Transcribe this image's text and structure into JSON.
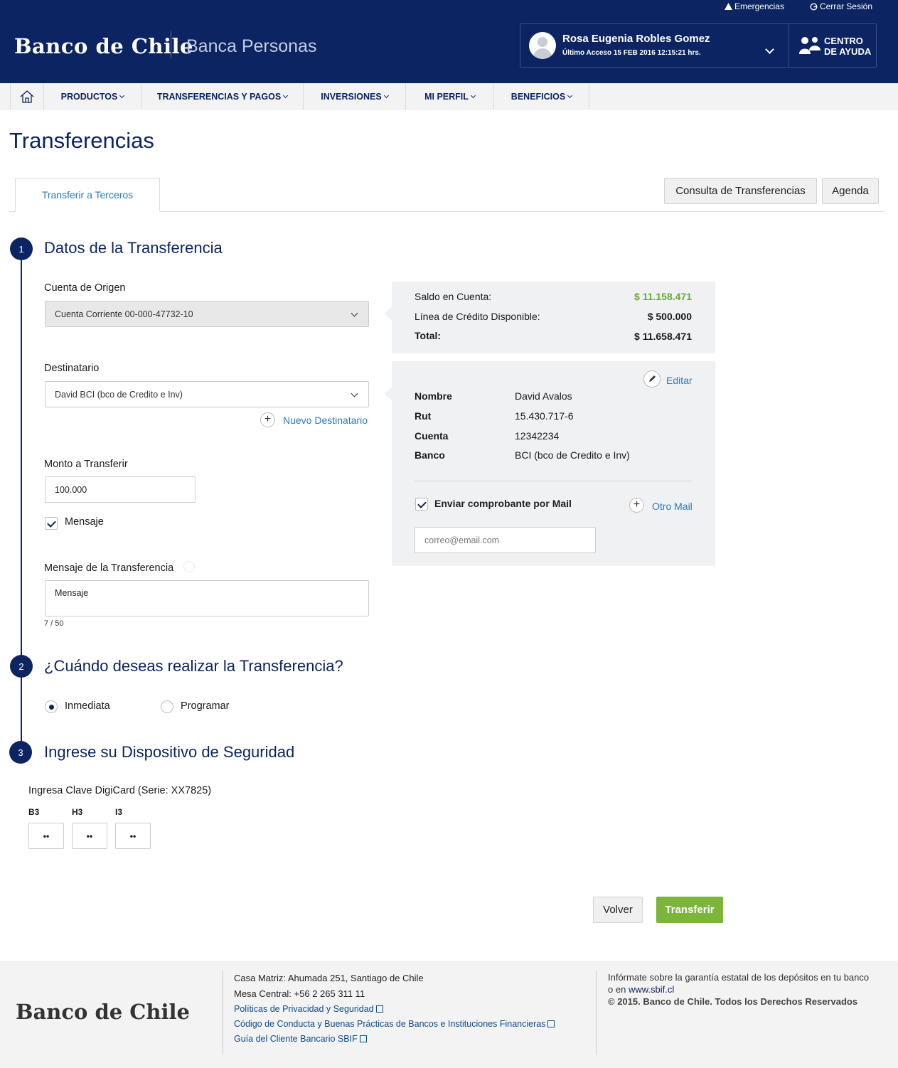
{
  "header": {
    "emergencias": "Emergencias",
    "cerrar_sesion": "Cerrar Sesión",
    "logo": "Banco de Chile",
    "section": "Banca Personas",
    "user_name": "Rosa Eugenia Robles Gomez",
    "last_access": "Último Acceso 15 FEB 2016 12:15:21 hrs.",
    "help_line1": "CENTRO",
    "help_line2": "DE AYUDA"
  },
  "nav": {
    "items": [
      "PRODUCTOS",
      "TRANSFERENCIAS Y PAGOS",
      "INVERSIONES",
      "MI PERFIL",
      "BENEFICIOS"
    ]
  },
  "page": {
    "title": "Transferencias",
    "tab_active": "Transferir a Terceros",
    "btn_consulta": "Consulta de Transferencias",
    "btn_agenda": "Agenda"
  },
  "step1": {
    "number": "1",
    "title": "Datos de la Transferencia",
    "origen_label": "Cuenta de Origen",
    "origen_value": "Cuenta Corriente 00-000-47732-10",
    "destinatario_label": "Destinatario",
    "destinatario_value": "David BCI (bco de Credito e Inv)",
    "nuevo_destinatario": "Nuevo Destinatario",
    "monto_label": "Monto a Transferir",
    "monto_value": "100.000",
    "mensaje_check": "Mensaje",
    "mensaje_label": "Mensaje de la Transferencia",
    "mensaje_value": "Mensaje",
    "char_count": "7 / 50"
  },
  "saldo": {
    "saldo_label": "Saldo en Cuenta:",
    "saldo_value": "$ 11.158.471",
    "linea_label": "Línea de Crédito Disponible:",
    "linea_value": "$ 500.000",
    "total_label": "Total:",
    "total_value": "$ 11.658.471",
    "saldo_color": "#6aaa2c"
  },
  "destinatario_panel": {
    "editar": "Editar",
    "nombre_label": "Nombre",
    "nombre_value": "David Avalos",
    "rut_label": "Rut",
    "rut_value": "15.430.717-6",
    "cuenta_label": "Cuenta",
    "cuenta_value": "12342234",
    "banco_label": "Banco",
    "banco_value": "BCI (bco de Credito e Inv)",
    "enviar_mail": "Enviar comprobante por Mail",
    "otro_mail": "Otro Mail",
    "email_placeholder": "correo@email.com"
  },
  "step2": {
    "number": "2",
    "title": "¿Cuándo deseas realizar la Transferencia?",
    "opt_inmediata": "Inmediata",
    "opt_programar": "Programar",
    "selected": "Inmediata"
  },
  "step3": {
    "number": "3",
    "title": "Ingrese su Dispositivo de Seguridad",
    "digicard_label": "Ingresa Clave DigiCard (Serie: XX7825)",
    "coords": [
      "B3",
      "H3",
      "I3"
    ],
    "values": [
      "••",
      "••",
      "••"
    ]
  },
  "actions": {
    "volver": "Volver",
    "transferir": "Transferir",
    "transferir_color": "#7bb53a"
  },
  "footer": {
    "logo": "Banco de Chile",
    "address": "Casa Matriz: Ahumada 251, Santiago de Chile",
    "phone": "Mesa Central: +56 2 265 311 11",
    "link1": "Políticas de Privacidad y Seguridad",
    "link2": "Código de Conducta y Buenas Prácticas de Bancos e Instituciones Financieras",
    "link3": "Guía del Cliente Bancario SBIF",
    "info_text": "Infórmate sobre la garantía estatal de los depósitos en tu banco o en",
    "info_link": "www.sbif.cl",
    "copyright": "© 2015. Banco de Chile. Todos los Derechos Reservados"
  },
  "colors": {
    "brand_navy": "#0c2461",
    "link_blue": "#2a7ab8"
  }
}
